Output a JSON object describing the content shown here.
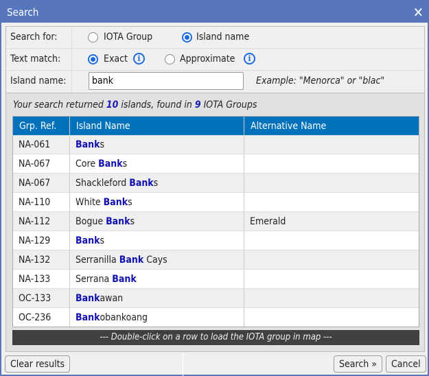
{
  "title": "Search",
  "form": {
    "search_for_label": "Search for:",
    "search_for_options": [
      "IOTA Group",
      "Island name"
    ],
    "search_for_selected": "Island name",
    "text_match_label": "Text match:",
    "text_match_options": [
      "Exact",
      "Approximate"
    ],
    "text_match_selected": "Exact",
    "island_name_label": "Island name:",
    "island_name_value": "bank",
    "example": "Example: \"Menorca\" or \"blac\""
  },
  "summary": {
    "prefix": "Your search returned ",
    "islands": "10",
    "mid": " islands, found in ",
    "groups": "9",
    "suffix": " IOTA Groups"
  },
  "table": {
    "headers": [
      "Grp. Ref.",
      "Island Name",
      "Alternative Name"
    ],
    "rows": [
      {
        "ref": "NA-061",
        "pre": "",
        "match": "Bank",
        "post": "s",
        "alt": ""
      },
      {
        "ref": "NA-067",
        "pre": "Core ",
        "match": "Bank",
        "post": "s",
        "alt": ""
      },
      {
        "ref": "NA-067",
        "pre": "Shackleford ",
        "match": "Bank",
        "post": "s",
        "alt": ""
      },
      {
        "ref": "NA-110",
        "pre": "White ",
        "match": "Bank",
        "post": "s",
        "alt": ""
      },
      {
        "ref": "NA-112",
        "pre": "Bogue ",
        "match": "Bank",
        "post": "s",
        "alt": "Emerald"
      },
      {
        "ref": "NA-129",
        "pre": "",
        "match": "Bank",
        "post": "s",
        "alt": ""
      },
      {
        "ref": "NA-132",
        "pre": "Serranilla ",
        "match": "Bank",
        "post": " Cays",
        "alt": ""
      },
      {
        "ref": "NA-133",
        "pre": "Serrana ",
        "match": "Bank",
        "post": "",
        "alt": ""
      },
      {
        "ref": "OC-133",
        "pre": "",
        "match": "Bank",
        "post": "awan",
        "alt": ""
      },
      {
        "ref": "OC-236",
        "pre": "",
        "match": "Bank",
        "post": "obankoang",
        "alt": ""
      }
    ],
    "footer": "--- Double-click on a row to load the IOTA group in map ---"
  },
  "buttons": {
    "clear": "Clear results",
    "search": "Search »",
    "cancel": "Cancel"
  }
}
